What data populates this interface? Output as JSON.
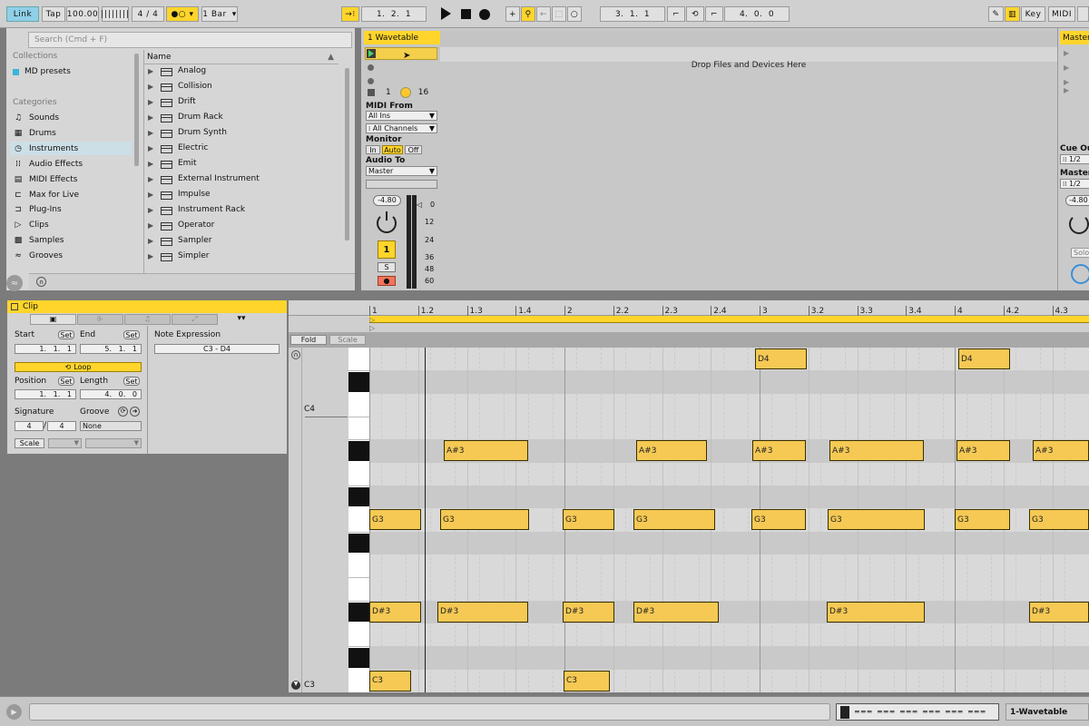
{
  "transport": {
    "link": "Link",
    "tap": "Tap",
    "tempo": "100.00",
    "signature": "4 / 4",
    "quantize": "1 Bar",
    "position": "1.  2.  1",
    "loop_start": "3.  1.  1",
    "loop_length": "4.  0.  0",
    "key": "Key",
    "midi": "MIDI"
  },
  "browser": {
    "search_placeholder": "Search (Cmd + F)",
    "collections_header": "Collections",
    "collections": [
      "MD presets"
    ],
    "categories_header": "Categories",
    "categories": [
      "Sounds",
      "Drums",
      "Instruments",
      "Audio Effects",
      "MIDI Effects",
      "Max for Live",
      "Plug-Ins",
      "Clips",
      "Samples",
      "Grooves"
    ],
    "name_header": "Name",
    "items": [
      "Analog",
      "Collision",
      "Drift",
      "Drum Rack",
      "Drum Synth",
      "Electric",
      "Emit",
      "External Instrument",
      "Impulse",
      "Instrument Rack",
      "Operator",
      "Sampler",
      "Simpler"
    ]
  },
  "track": {
    "name": "1 Wavetable",
    "drop_hint": "Drop Files and Devices Here",
    "stop_count": "1",
    "pitch": "16",
    "midi_from_label": "MIDI From",
    "midi_from_value": "All Ins",
    "channel_value": "All Channels",
    "monitor_label": "Monitor",
    "monitor_in": "In",
    "monitor_auto": "Auto",
    "monitor_off": "Off",
    "audio_to_label": "Audio To",
    "audio_to_value": "Master",
    "volume": "-4.80",
    "track_number": "1",
    "solo": "S",
    "meter_scale": [
      "0",
      "12",
      "24",
      "36",
      "48",
      "60"
    ]
  },
  "master": {
    "name": "Master",
    "cue_out": "Cue Out",
    "cue_value": "1/2",
    "master_out": "Master",
    "master_value": "1/2",
    "volume": "-4.80",
    "solo": "Solo"
  },
  "clip": {
    "title": "Clip",
    "start_label": "Start",
    "end_label": "End",
    "set": "Set",
    "start_value": "1.   1.   1",
    "end_value": "5.   1.   1",
    "loop": "Loop",
    "position_label": "Position",
    "length_label": "Length",
    "position_value": "1.   1.   1",
    "length_value": "4.   0.   0",
    "signature_label": "Signature",
    "sig_num": "4",
    "sig_den": "4",
    "groove_label": "Groove",
    "groove_value": "None",
    "scale_label": "Scale",
    "note_expression_label": "Note Expression",
    "note_range": "C3 - D4"
  },
  "pianoroll": {
    "fold": "Fold",
    "scale": "Scale",
    "key_labels": [
      "C4",
      "C3"
    ],
    "ruler": [
      "1",
      "1.2",
      "1.3",
      "1.4",
      "2",
      "2.2",
      "2.3",
      "2.4",
      "3",
      "3.2",
      "3.3",
      "3.4",
      "4",
      "4.2",
      "4.3"
    ],
    "note_names": [
      "D4",
      "A#3",
      "G3",
      "D#3",
      "C3"
    ]
  },
  "bottom": {
    "track_label": "1-Wavetable"
  },
  "colors": {
    "accent": "#ffd52b",
    "note": "#f5c954",
    "selection": "#ccdfe6"
  }
}
